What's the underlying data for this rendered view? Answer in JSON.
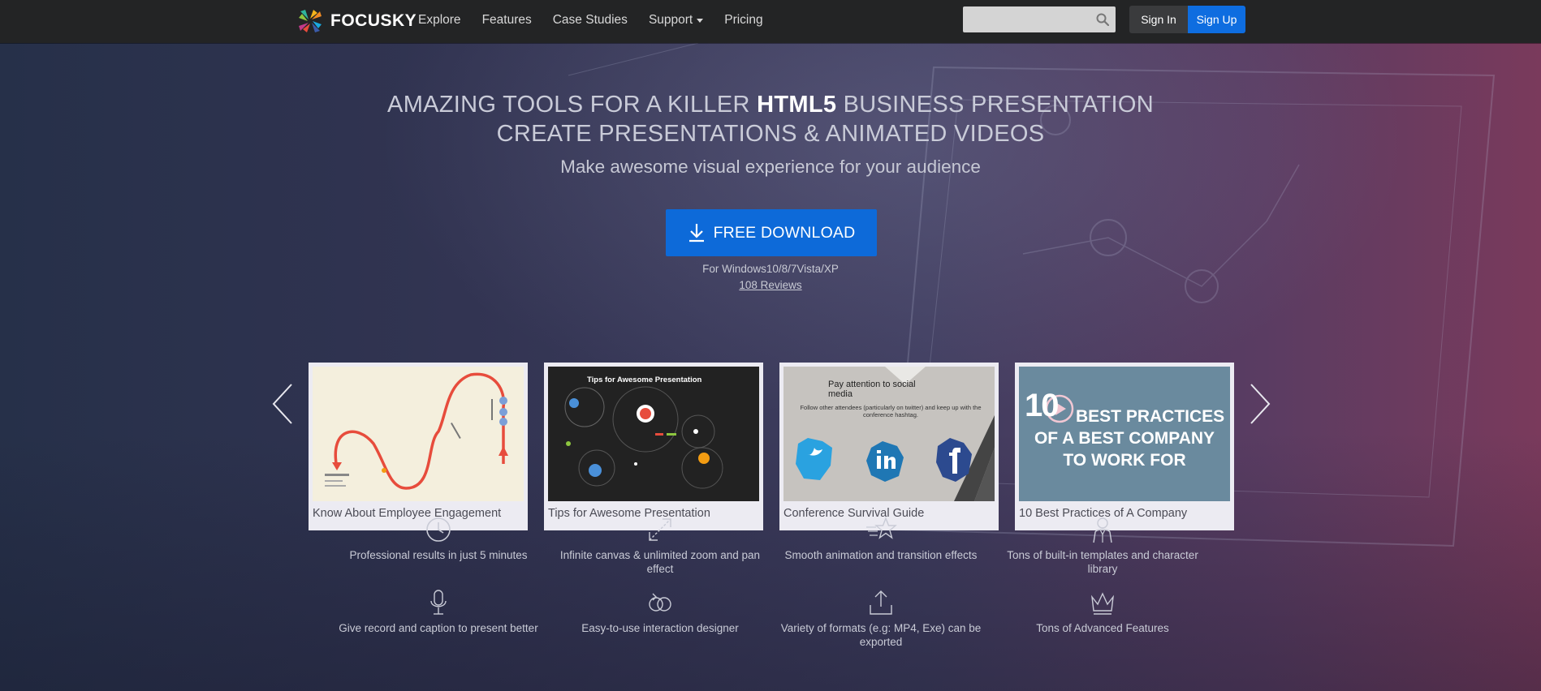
{
  "nav": {
    "logo_text": "FOCUSKY",
    "links": [
      "Explore",
      "Features",
      "Case Studies",
      "Support",
      "Pricing"
    ],
    "search_placeholder": "",
    "signin_label": "Sign In",
    "signup_label": "Sign Up"
  },
  "hero": {
    "headline_prefix": "AMAZING TOOLS FOR A KILLER ",
    "headline_strong": "HTML5",
    "headline_suffix": " BUSINESS PRESENTATION",
    "headline2": "CREATE PRESENTATIONS & ANIMATED VIDEOS",
    "tagline": "Make awesome visual experience for your audience",
    "download_label": "FREE DOWNLOAD",
    "os_text": "For Windows10/8/7Vista/XP",
    "reviews_link": "108 Reviews"
  },
  "carousel": {
    "cards": [
      {
        "title": "Know About Employee Engagement"
      },
      {
        "title": "Tips for Awesome Presentation",
        "thumb_title": "Tips for Awesome Presentation"
      },
      {
        "title": "Conference Survival Guide",
        "thumb_heading": "Pay attention to social media",
        "thumb_text": "Follow other attendees (particularly on twitter) and keep up with the conference hashtag."
      },
      {
        "title": "10 Best Practices of A Company",
        "thumb_number": "10",
        "thumb_line1": "BEST PRACTICES",
        "thumb_line2": "OF A BEST COMPANY",
        "thumb_line3": "TO WORK FOR"
      }
    ]
  },
  "features": [
    {
      "icon": "clock-icon",
      "text": "Professional results in just 5 minutes"
    },
    {
      "icon": "zoom-expand-icon",
      "text": "Infinite canvas & unlimited zoom and pan effect"
    },
    {
      "icon": "star-motion-icon",
      "text": "Smooth animation and transition effects"
    },
    {
      "icon": "character-icon",
      "text": "Tons of built-in templates and character library"
    },
    {
      "icon": "microphone-icon",
      "text": "Give record and caption to present better"
    },
    {
      "icon": "interaction-icon",
      "text": "Easy-to-use interaction designer"
    },
    {
      "icon": "export-icon",
      "text": "Variety of formats (e.g: MP4, Exe) can be exported"
    },
    {
      "icon": "crown-icon",
      "text": "Tons of Advanced Features"
    }
  ],
  "colors": {
    "nav_bg": "#232425",
    "brand_blue": "#0d6ad9",
    "card_bg": "#ecebf2"
  }
}
